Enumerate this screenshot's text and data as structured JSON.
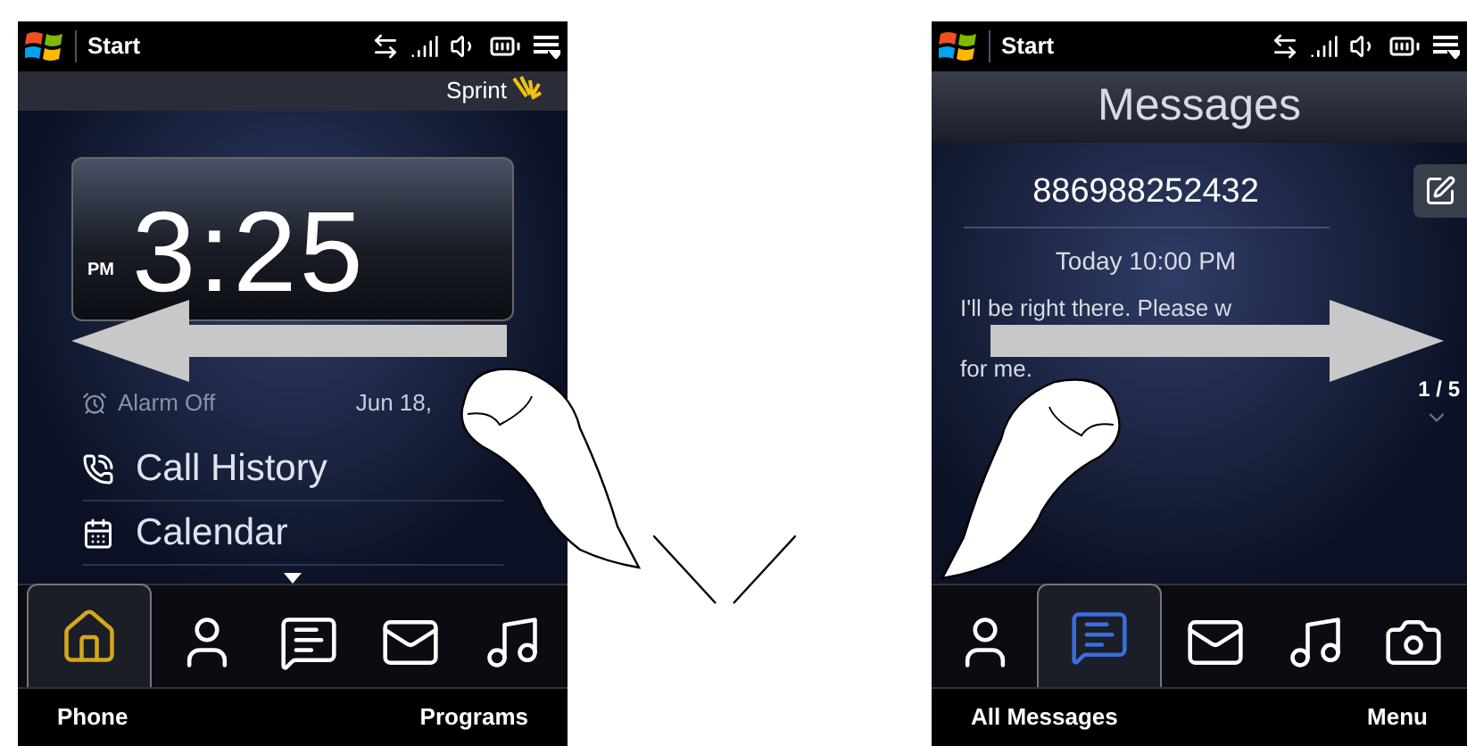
{
  "screens": [
    {
      "kind": "home",
      "status_bar": {
        "title": "Start"
      },
      "header": {
        "carrier": "Sprint"
      },
      "clock": {
        "time": "3:25",
        "ampm": "PM"
      },
      "alarm": "Alarm Off",
      "date": "Jun 18,",
      "items": [
        {
          "kind": "calls",
          "label": "Call History"
        },
        {
          "kind": "calendar",
          "label": "Calendar"
        }
      ],
      "tabs": [
        {
          "kind": "home",
          "selected": true
        },
        {
          "kind": "people",
          "selected": false
        },
        {
          "kind": "messages",
          "selected": false
        },
        {
          "kind": "mail",
          "selected": false
        },
        {
          "kind": "music",
          "selected": false
        }
      ],
      "softkeys": [
        "Phone",
        "Programs"
      ]
    },
    {
      "kind": "messages",
      "status_bar": {
        "title": "Start"
      },
      "header": {
        "title": "Messages"
      },
      "sender": "886988252432",
      "time": "Today 10:00 PM",
      "message_lines": [
        "I'll be right there. Please w",
        "for me."
      ],
      "counter": "1 / 5",
      "tabs": [
        {
          "kind": "people",
          "selected": false
        },
        {
          "kind": "messages",
          "selected": true
        },
        {
          "kind": "mail",
          "selected": false
        },
        {
          "kind": "music",
          "selected": false
        },
        {
          "kind": "camera",
          "selected": false
        }
      ],
      "softkeys": [
        "All Messages",
        "Menu"
      ]
    }
  ]
}
